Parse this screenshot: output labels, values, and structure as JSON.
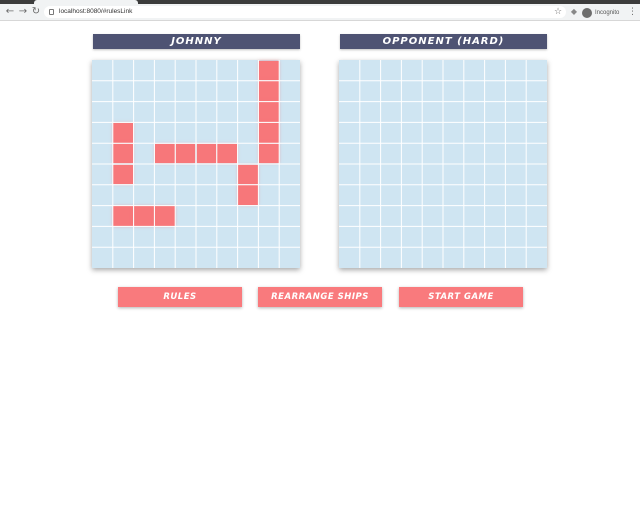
{
  "browser": {
    "url": "localhost:8080/#rulesLink",
    "incognito_label": "Incognito",
    "icons": {
      "back": "back-arrow-icon",
      "forward": "forward-arrow-icon",
      "reload": "reload-icon",
      "lock": "lock-icon",
      "star": "bookmark-star-icon",
      "extension": "extension-icon",
      "incognito": "incognito-icon",
      "menu": "kebab-menu-icon"
    }
  },
  "colors": {
    "title_bar": "#4e5373",
    "board": "#cfe5f2",
    "ship": "#f7777a",
    "button": "#f97a7d"
  },
  "player": {
    "name": "JOHNNY",
    "board": {
      "rows": 10,
      "cols": 10,
      "ship_cells": [
        [
          0,
          8
        ],
        [
          1,
          8
        ],
        [
          2,
          8
        ],
        [
          3,
          8
        ],
        [
          4,
          8
        ],
        [
          3,
          1
        ],
        [
          4,
          1
        ],
        [
          5,
          1
        ],
        [
          4,
          3
        ],
        [
          4,
          4
        ],
        [
          4,
          5
        ],
        [
          4,
          6
        ],
        [
          5,
          7
        ],
        [
          6,
          7
        ],
        [
          7,
          1
        ],
        [
          7,
          2
        ],
        [
          7,
          3
        ]
      ]
    }
  },
  "opponent": {
    "name": "OPPONENT (HARD)",
    "board": {
      "rows": 10,
      "cols": 10,
      "ship_cells": []
    }
  },
  "actions": {
    "rules_label": "RULES",
    "rearrange_label": "REARRANGE SHIPS",
    "start_label": "START GAME"
  }
}
